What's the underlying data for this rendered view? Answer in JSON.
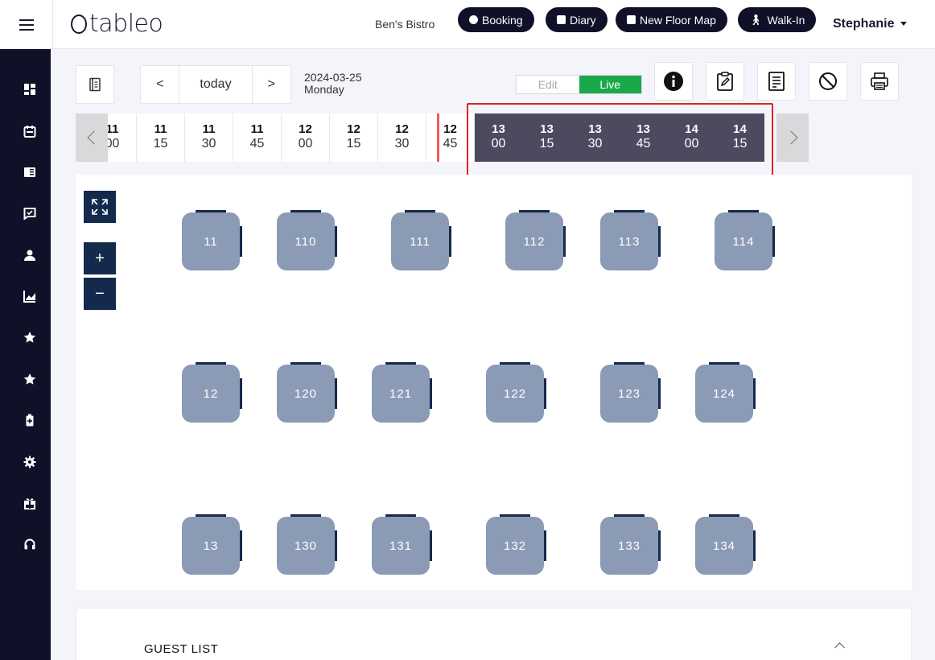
{
  "brand": {
    "name": "tableo"
  },
  "header": {
    "venue": "Ben's Bistro",
    "buttons": [
      {
        "label": "Booking",
        "icon": "plus-circle-icon"
      },
      {
        "label": "Diary",
        "icon": "calendar-icon"
      },
      {
        "label": "New Floor Map",
        "icon": "calendar-icon"
      },
      {
        "label": "Walk-In",
        "icon": "walking-person-icon"
      }
    ],
    "user": "Stephanie"
  },
  "sidebar": {
    "items": [
      {
        "name": "dashboard-icon"
      },
      {
        "name": "calendar-icon"
      },
      {
        "name": "book-icon"
      },
      {
        "name": "chat-check-icon"
      },
      {
        "name": "person-icon"
      },
      {
        "name": "chart-icon"
      },
      {
        "name": "star-icon"
      },
      {
        "name": "star-icon"
      },
      {
        "name": "battery-icon"
      },
      {
        "name": "gear-icon"
      },
      {
        "name": "gift-icon"
      },
      {
        "name": "headset-icon"
      }
    ]
  },
  "toolbar": {
    "prev_label": "<",
    "today_label": "today",
    "next_label": ">",
    "date": "2024-03-25",
    "weekday": "Monday",
    "mode_edit": "Edit",
    "mode_live": "Live",
    "active_mode": "Live"
  },
  "timeline": {
    "slots": [
      {
        "h": "11",
        "m": "00"
      },
      {
        "h": "11",
        "m": "15"
      },
      {
        "h": "11",
        "m": "30"
      },
      {
        "h": "11",
        "m": "45"
      },
      {
        "h": "12",
        "m": "00"
      },
      {
        "h": "12",
        "m": "15"
      },
      {
        "h": "12",
        "m": "30"
      },
      {
        "h": "12",
        "m": "45"
      },
      {
        "h": "13",
        "m": "00"
      },
      {
        "h": "13",
        "m": "15"
      },
      {
        "h": "13",
        "m": "30"
      },
      {
        "h": "13",
        "m": "45"
      },
      {
        "h": "14",
        "m": "00"
      },
      {
        "h": "14",
        "m": "15"
      }
    ]
  },
  "floor": {
    "tables": [
      "11",
      "110",
      "111",
      "112",
      "113",
      "114",
      "12",
      "120",
      "121",
      "122",
      "123",
      "124",
      "13",
      "130",
      "131",
      "132",
      "133",
      "134"
    ]
  },
  "guest_list": {
    "title": "GUEST LIST"
  },
  "colors": {
    "navy": "#101028",
    "live_green": "#1aa94a",
    "table_fill": "#8b9ab5",
    "highlight_red": "#e32222",
    "slot_selected": "#4d4a60"
  }
}
